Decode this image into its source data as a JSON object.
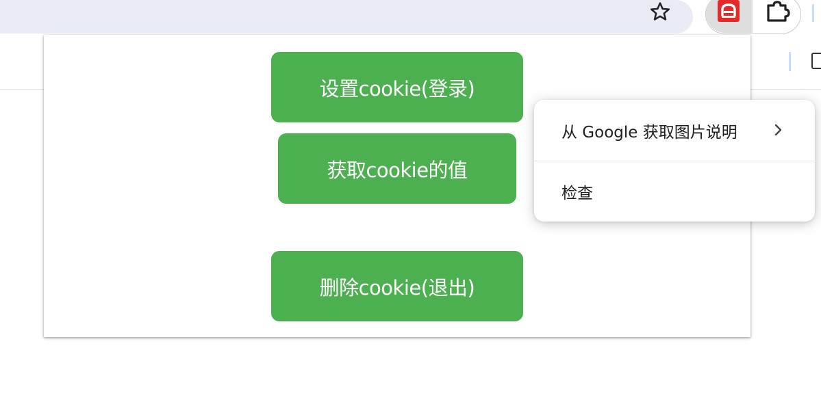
{
  "popup": {
    "buttons": {
      "set_cookie": "设置cookie(登录)",
      "get_cookie": "获取cookie的值",
      "delete_cookie": "删除cookie(退出)"
    },
    "button_color": "#4caf50"
  },
  "context_menu": {
    "items": [
      {
        "label": "从 Google 获取图片说明",
        "has_submenu": true
      },
      {
        "label": "检查",
        "has_submenu": false
      }
    ]
  },
  "toolbar": {
    "icons": [
      "star-icon",
      "extension-app-icon",
      "puzzle-icon"
    ],
    "extension_icon_color": "#e32a2a"
  }
}
